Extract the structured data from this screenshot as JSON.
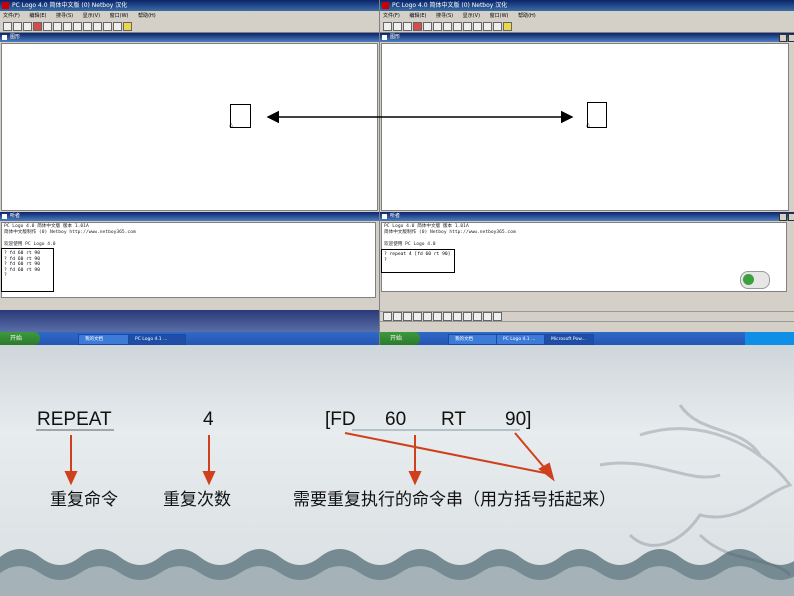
{
  "left_window": {
    "title": "PC Logo 4.0 简体中文版  (0) Netboy  汉化",
    "menu": [
      "文件(F)",
      "编辑(E)",
      "搜寻(S)",
      "显示(V)",
      "窗口(W)",
      "帮助(H)"
    ],
    "graphics_label": "图形",
    "listener_label": "听者",
    "listener_header": [
      "PC Logo 4.0 简体中文版  版本  1.01A",
      "简体中文版制作  (0) Netboy  http://www.netboy365.com",
      "",
      "欢迎使用 PC Logo 4.0"
    ],
    "commands": [
      "? fd 60 rt 90",
      "? fd 60 rt 90",
      "? fd 60 rt 90",
      "? fd 60 rt 90",
      "?"
    ],
    "taskbar_start": "开始",
    "taskbar_items": [
      "我的文档",
      "PC Logo 4.1 ..."
    ]
  },
  "right_window": {
    "title": "PC Logo 4.0 简体中文版  (0) Netboy  汉化",
    "menu": [
      "文件(F)",
      "编辑(E)",
      "搜寻(S)",
      "显示(V)",
      "窗口(W)",
      "帮助(H)"
    ],
    "graphics_label": "图形",
    "listener_label": "听者",
    "listener_header": [
      "PC Logo 4.0 简体中文版  版本  1.01A",
      "简体中文版制作  (0) Netboy  http://www.netboy365.com",
      "",
      "欢迎使用 PC Logo 4.0"
    ],
    "commands": [
      "? repeat 4 [fd 60 rt 90]",
      "?"
    ],
    "taskbar_start": "开始",
    "taskbar_items": [
      "我的文档",
      "PC Logo 4.1 ...",
      "Microsoft Pow..."
    ]
  },
  "slide": {
    "repeat_word": "REPEAT",
    "count": "4",
    "bracket_open": "[FD",
    "fd_value": "60",
    "rt_word": "RT",
    "rt_value": "90]",
    "label_command": "重复命令",
    "label_count": "重复次数",
    "label_string": "需要重复执行的命令串（用方括号括起来）"
  },
  "colors": {
    "arrow": "#d0401c",
    "title_blue": "#0a246a",
    "xp_taskbar": "#2456b4"
  }
}
